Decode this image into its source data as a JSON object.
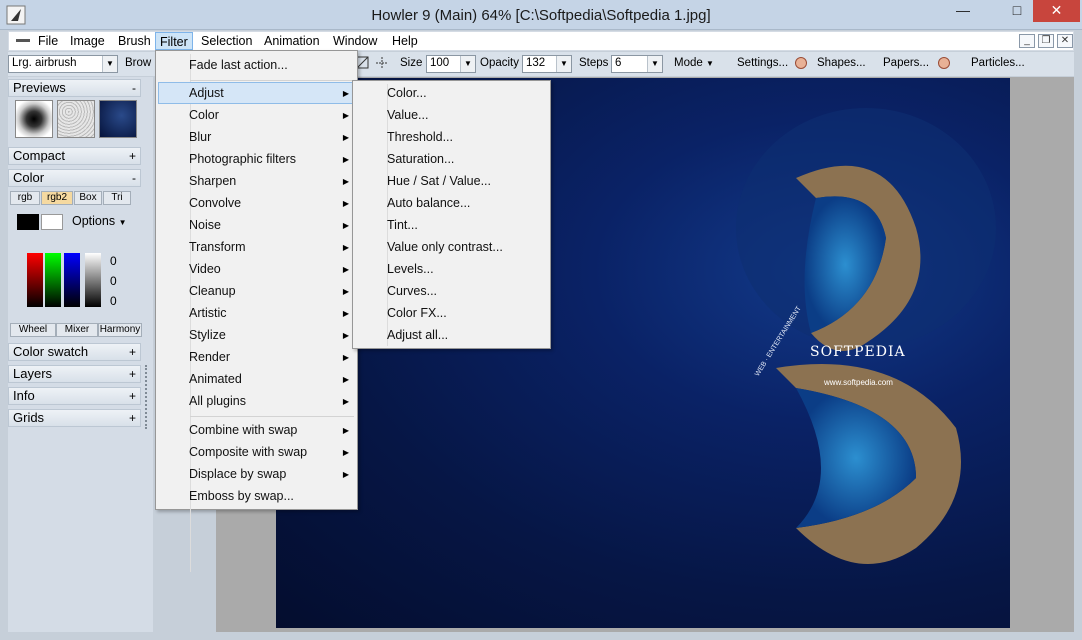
{
  "window": {
    "title": "Howler 9  (Main)   64%   [C:\\Softpedia\\Softpedia 1.jpg]"
  },
  "menubar": [
    "File",
    "Image",
    "Brush",
    "Filter",
    "Selection",
    "Animation",
    "Window",
    "Help"
  ],
  "toolbar": {
    "brush": "Lrg. airbrush",
    "browse": "Brow",
    "size_label": "Size",
    "size_value": "100",
    "opacity_label": "Opacity",
    "opacity_value": "132",
    "steps_label": "Steps",
    "steps_value": "6",
    "mode": "Mode",
    "settings": "Settings...",
    "shapes": "Shapes...",
    "papers": "Papers...",
    "particles": "Particles..."
  },
  "panel": {
    "previews": "Previews",
    "previews_sign": "-",
    "compact": "Compact",
    "compact_sign": "+",
    "color": "Color",
    "color_sign": "-",
    "color_tabs": [
      "rgb",
      "rgb2",
      "Box",
      "Tri"
    ],
    "options": "Options",
    "rgb_values": [
      "0",
      "0",
      "0"
    ],
    "bottom_tabs": [
      "Wheel",
      "Mixer",
      "Harmony"
    ],
    "color_swatch": "Color swatch",
    "layers": "Layers",
    "info": "Info",
    "grids": "Grids",
    "plus": "+"
  },
  "filter_menu": {
    "fade": "Fade last action...",
    "items": [
      "Adjust",
      "Color",
      "Blur",
      "Photographic filters",
      "Sharpen",
      "Convolve",
      "Noise",
      "Transform",
      "Video",
      "Cleanup",
      "Artistic",
      "Stylize",
      "Render",
      "Animated",
      "All plugins"
    ],
    "swap_items": [
      "Combine with swap",
      "Composite with swap",
      "Displace by swap"
    ],
    "emboss": "Emboss by swap..."
  },
  "adjust_menu": [
    "Color...",
    "Value...",
    "Threshold...",
    "Saturation...",
    "Hue / Sat / Value...",
    "Auto balance...",
    "Tint...",
    "Value only contrast...",
    "Levels...",
    "Curves...",
    "Color FX...",
    "Adjust all..."
  ],
  "image_text": {
    "logo": "SOFTPEDIA",
    "url": "www.softpedia.com",
    "web": "WEB · ENTERTAINMENT"
  },
  "colors": {
    "accent": "#cde4f7",
    "image_bg": "#061645",
    "close": "#c8453d"
  }
}
